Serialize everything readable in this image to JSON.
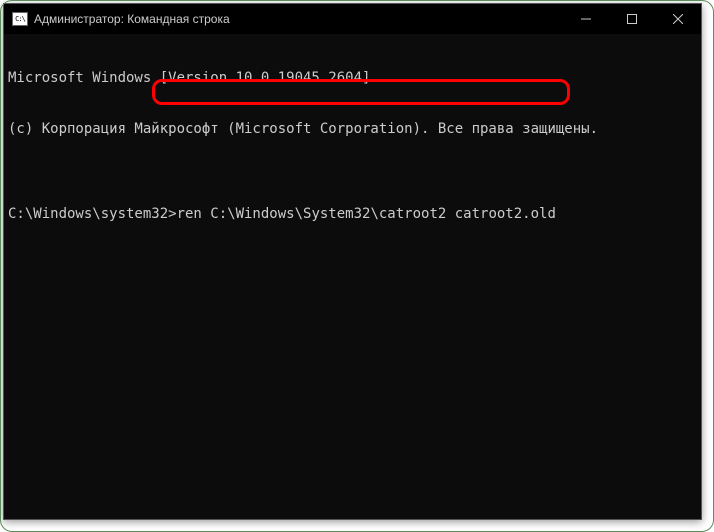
{
  "titlebar": {
    "title": "Администратор: Командная строка"
  },
  "terminal": {
    "line1": "Microsoft Windows [Version 10.0.19045.2604]",
    "line2": "(c) Корпорация Майкрософт (Microsoft Corporation). Все права защищены.",
    "blank": "",
    "prompt": "C:\\Windows\\system32>",
    "command": "ren C:\\Windows\\System32\\catroot2 catroot2.old"
  },
  "colors": {
    "bg": "#0c0c0c",
    "fg": "#cccccc",
    "titlebar": "#000000",
    "highlight": "#ff0000"
  }
}
